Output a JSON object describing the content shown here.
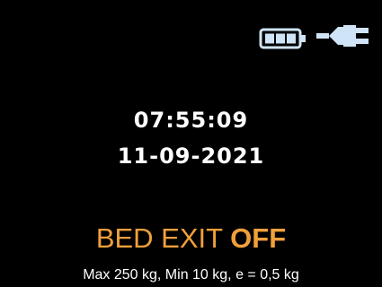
{
  "status": {
    "battery_icon": "battery-icon",
    "power_icon": "plug-icon",
    "icon_color": "#cfe4f6"
  },
  "clock": {
    "time": "07:55:09",
    "date": "11-09-2021"
  },
  "bed_exit": {
    "label": "BED EXIT",
    "state": "OFF",
    "color": "#f0a03a"
  },
  "scale_specs": "Max 250 kg, Min 10 kg, e = 0,5 kg"
}
